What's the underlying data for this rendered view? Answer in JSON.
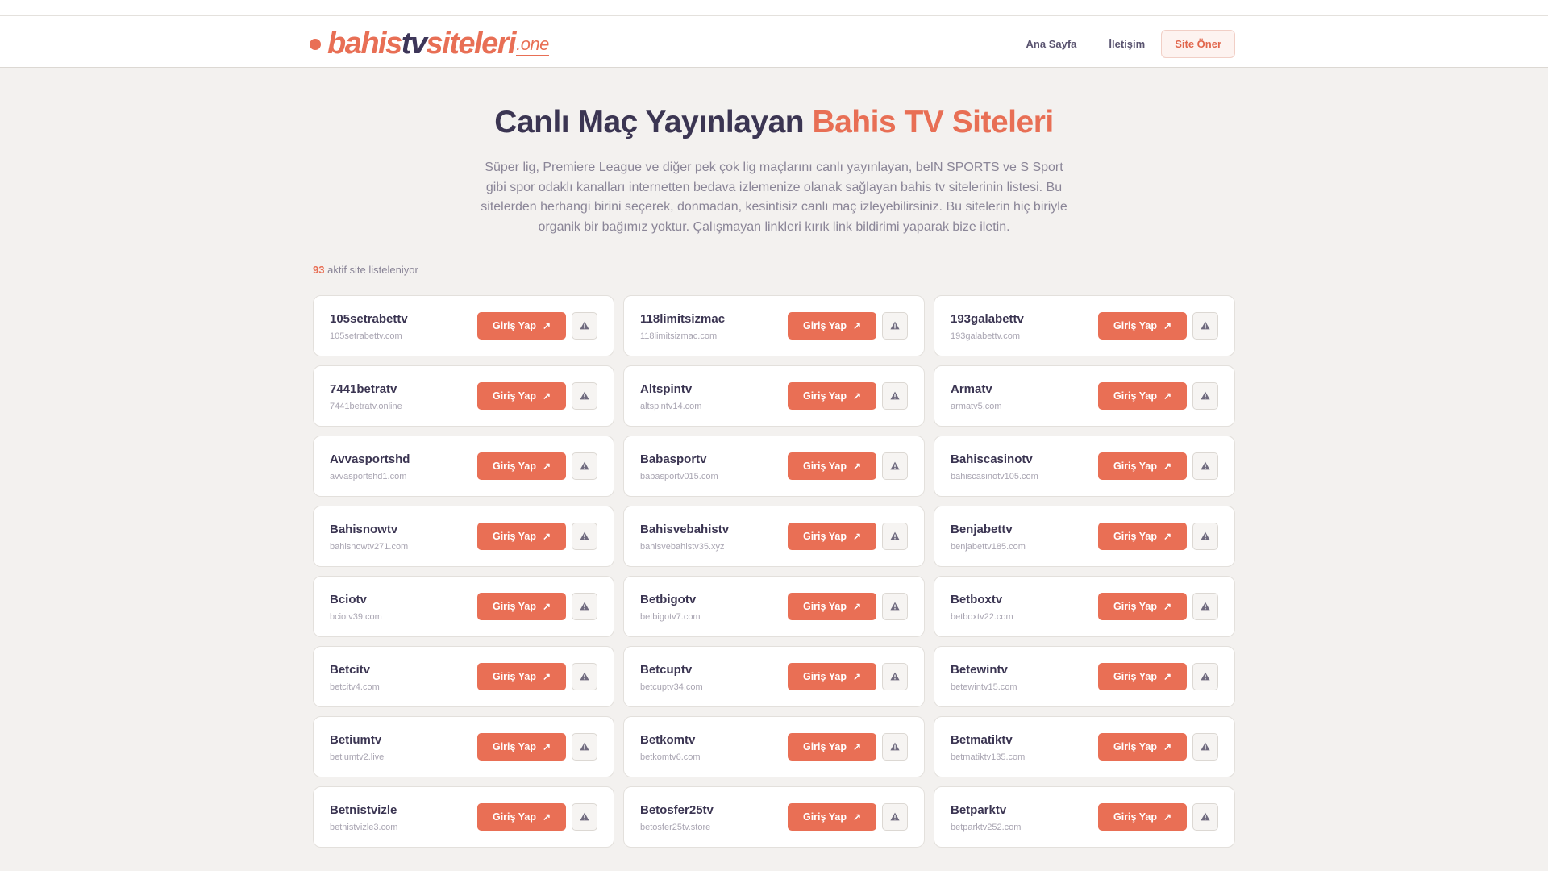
{
  "header": {
    "logo": {
      "part1": "bahis",
      "part2": "tv",
      "part3": "siteleri",
      "tld": ".one"
    },
    "nav": {
      "home": "Ana Sayfa",
      "contact": "İletişim",
      "suggest": "Site Öner"
    }
  },
  "hero": {
    "title_main": "Canlı Maç Yayınlayan",
    "title_accent": "Bahis TV Siteleri",
    "description": "Süper lig, Premiere League ve diğer pek çok lig maçlarını canlı yayınlayan, beIN SPORTS ve S Sport gibi spor odaklı kanalları internetten bedava izlemenize olanak sağlayan bahis tv sitelerinin listesi. Bu sitelerden herhangi birini seçerek, donmadan, kesintisiz canlı maç izleyebilirsiniz. Bu sitelerin hiç biriyle organik bir bağımız yoktur. Çalışmayan linkleri kırık link bildirimi yaparak bize iletin."
  },
  "count": {
    "number": "93",
    "label": "aktif site listeleniyor"
  },
  "button_label": "Giriş Yap",
  "colors": {
    "accent": "#e96f55",
    "dark": "#3b3552",
    "background": "#f3f1ef"
  },
  "icons": {
    "go": "arrow-up-right-icon",
    "report": "warning-triangle-icon"
  },
  "sites": [
    {
      "name": "105setrabettv",
      "domain": "105setrabettv.com"
    },
    {
      "name": "118limitsizmac",
      "domain": "118limitsizmac.com"
    },
    {
      "name": "193galabettv",
      "domain": "193galabettv.com"
    },
    {
      "name": "7441betratv",
      "domain": "7441betratv.online"
    },
    {
      "name": "Altspintv",
      "domain": "altspintv14.com"
    },
    {
      "name": "Armatv",
      "domain": "armatv5.com"
    },
    {
      "name": "Avvasportshd",
      "domain": "avvasportshd1.com"
    },
    {
      "name": "Babasportv",
      "domain": "babasportv015.com"
    },
    {
      "name": "Bahiscasinotv",
      "domain": "bahiscasinotv105.com"
    },
    {
      "name": "Bahisnowtv",
      "domain": "bahisnowtv271.com"
    },
    {
      "name": "Bahisvebahistv",
      "domain": "bahisvebahistv35.xyz"
    },
    {
      "name": "Benjabettv",
      "domain": "benjabettv185.com"
    },
    {
      "name": "Bciotv",
      "domain": "bciotv39.com"
    },
    {
      "name": "Betbigotv",
      "domain": "betbigotv7.com"
    },
    {
      "name": "Betboxtv",
      "domain": "betboxtv22.com"
    },
    {
      "name": "Betcitv",
      "domain": "betcitv4.com"
    },
    {
      "name": "Betcuptv",
      "domain": "betcuptv34.com"
    },
    {
      "name": "Betewintv",
      "domain": "betewintv15.com"
    },
    {
      "name": "Betiumtv",
      "domain": "betiumtv2.live"
    },
    {
      "name": "Betkomtv",
      "domain": "betkomtv6.com"
    },
    {
      "name": "Betmatiktv",
      "domain": "betmatiktv135.com"
    },
    {
      "name": "Betnistvizle",
      "domain": "betnistvizle3.com"
    },
    {
      "name": "Betosfer25tv",
      "domain": "betosfer25tv.store"
    },
    {
      "name": "Betparktv",
      "domain": "betparktv252.com"
    }
  ]
}
